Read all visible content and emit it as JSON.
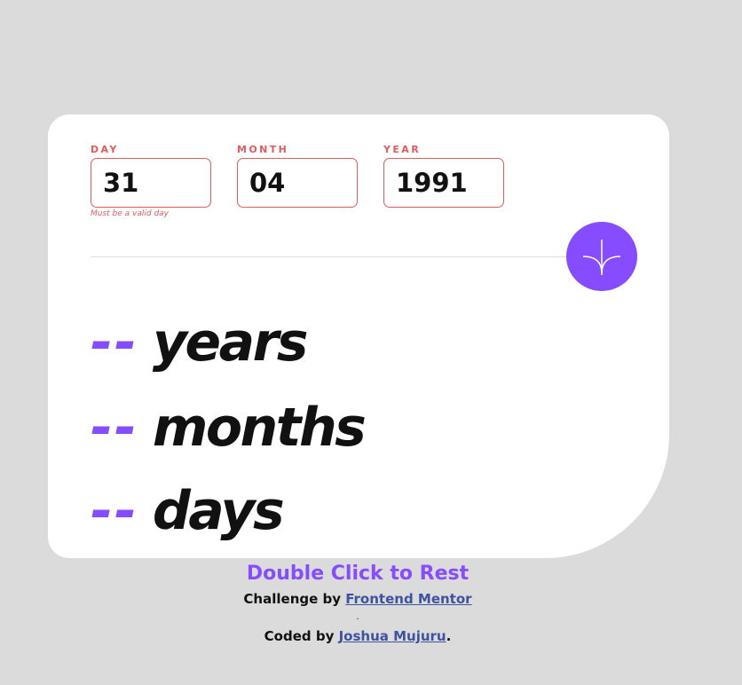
{
  "form": {
    "day": {
      "label": "DAY",
      "value": "31",
      "error": "Must be a valid day"
    },
    "month": {
      "label": "MONTH",
      "value": "04"
    },
    "year": {
      "label": "YEAR",
      "value": "1991"
    },
    "submit_icon": "arrow-down-icon"
  },
  "results": {
    "years": {
      "value": "--",
      "unit": "years"
    },
    "months": {
      "value": "--",
      "unit": "months"
    },
    "days": {
      "value": "--",
      "unit": "days"
    }
  },
  "footer": {
    "reset_text": "Double Click to Rest",
    "challenge_prefix": "Challenge by",
    "challenge_link": "Frontend Mentor",
    "separator": ".",
    "coded_prefix": "Coded by",
    "coded_link": "Joshua Mujuru",
    "coded_suffix": "."
  },
  "colors": {
    "accent": "#854dff",
    "error": "#e05c5c",
    "background": "#dbdbdb",
    "card": "#ffffff",
    "link": "#3e52a3"
  }
}
